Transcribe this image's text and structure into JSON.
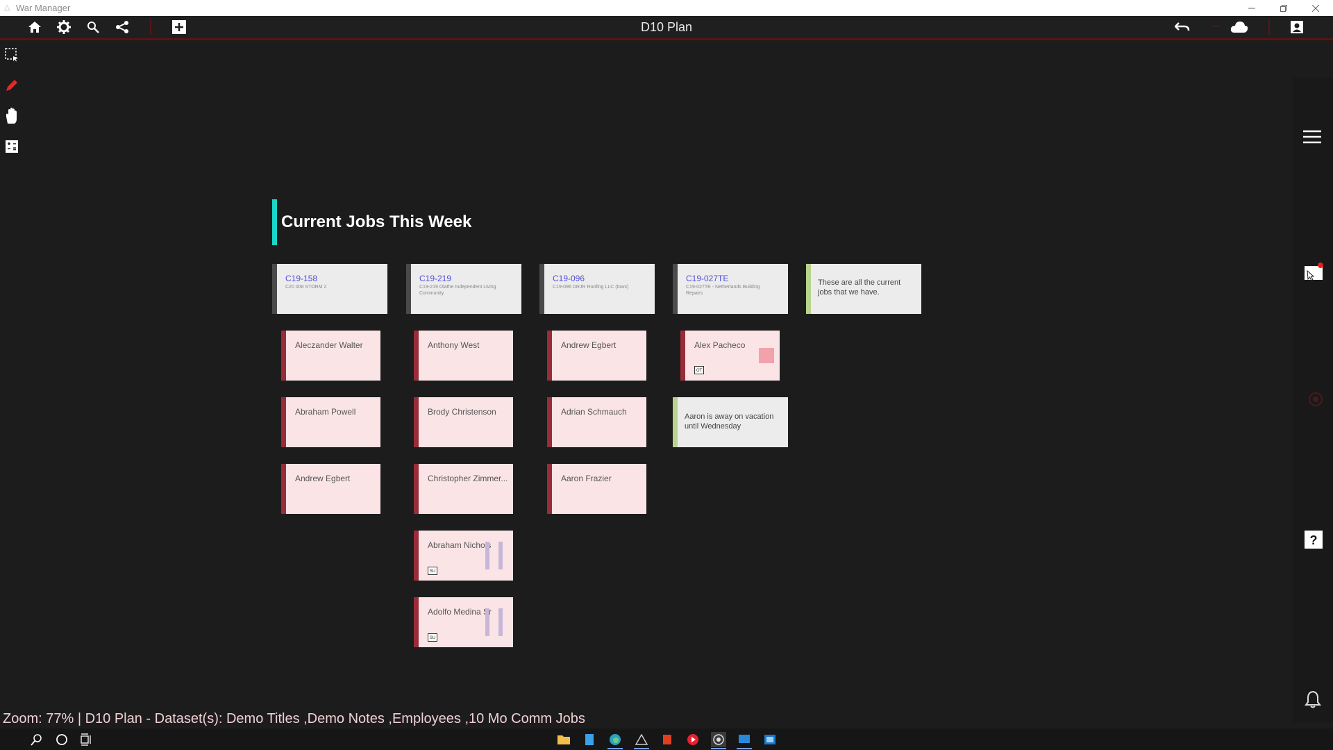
{
  "window": {
    "app_title": "War Manager"
  },
  "toolbar": {
    "doc_title": "D10 Plan"
  },
  "canvas": {
    "section_title": "Current Jobs This Week",
    "jobs": [
      {
        "id": "C19-158",
        "desc": "C20 008 STORM 2"
      },
      {
        "id": "C19-219",
        "desc": "C19-219 Olathe Independent Living Community"
      },
      {
        "id": "C19-096",
        "desc": "C19-096 DRJR Roofing LLC (tows)"
      },
      {
        "id": "C19-027TE",
        "desc": "C19-027TE - Netherlands Building Repairs"
      }
    ],
    "intro_note": "These are all the current jobs that we have.",
    "columns": [
      [
        "Aleczander Walter",
        "Abraham Powell",
        "Andrew Egbert"
      ],
      [
        "Anthony West",
        "Brody Christenson",
        "Christopher Zimmer...",
        "Abraham Nichols",
        "Adolfo Medina Sr"
      ],
      [
        "Andrew Egbert",
        "Adrian Schmauch",
        "Aaron Frazier"
      ],
      [
        "Alex Pacheco"
      ]
    ],
    "vacation_note": "Aaron is away on vacation until Wednesday",
    "badges": {
      "alex": "OT",
      "abraham_nichols": "SU",
      "adolfo": "SU"
    },
    "colors": {
      "accent": "#18d6c8",
      "employee_card": "#fbe4e6",
      "employee_stripe": "#9a2c3a",
      "job_link": "#5050d8",
      "note_stripe": "#b8d48c"
    }
  },
  "status": {
    "text": "Zoom: 77% | D10 Plan - Dataset(s): Demo Titles ,Demo Notes ,Employees ,10 Mo Comm Jobs"
  },
  "icons": {
    "toolbar": [
      "home-icon",
      "gear-icon",
      "search-icon",
      "share-icon",
      "add-icon",
      "undo-icon",
      "cloud-icon",
      "profile-icon"
    ],
    "left_tools": [
      "select-icon",
      "pencil-icon",
      "hand-icon",
      "calculator-icon"
    ],
    "right_panel": [
      "menu-icon",
      "mail-icon",
      "help-icon",
      "bell-icon"
    ]
  }
}
